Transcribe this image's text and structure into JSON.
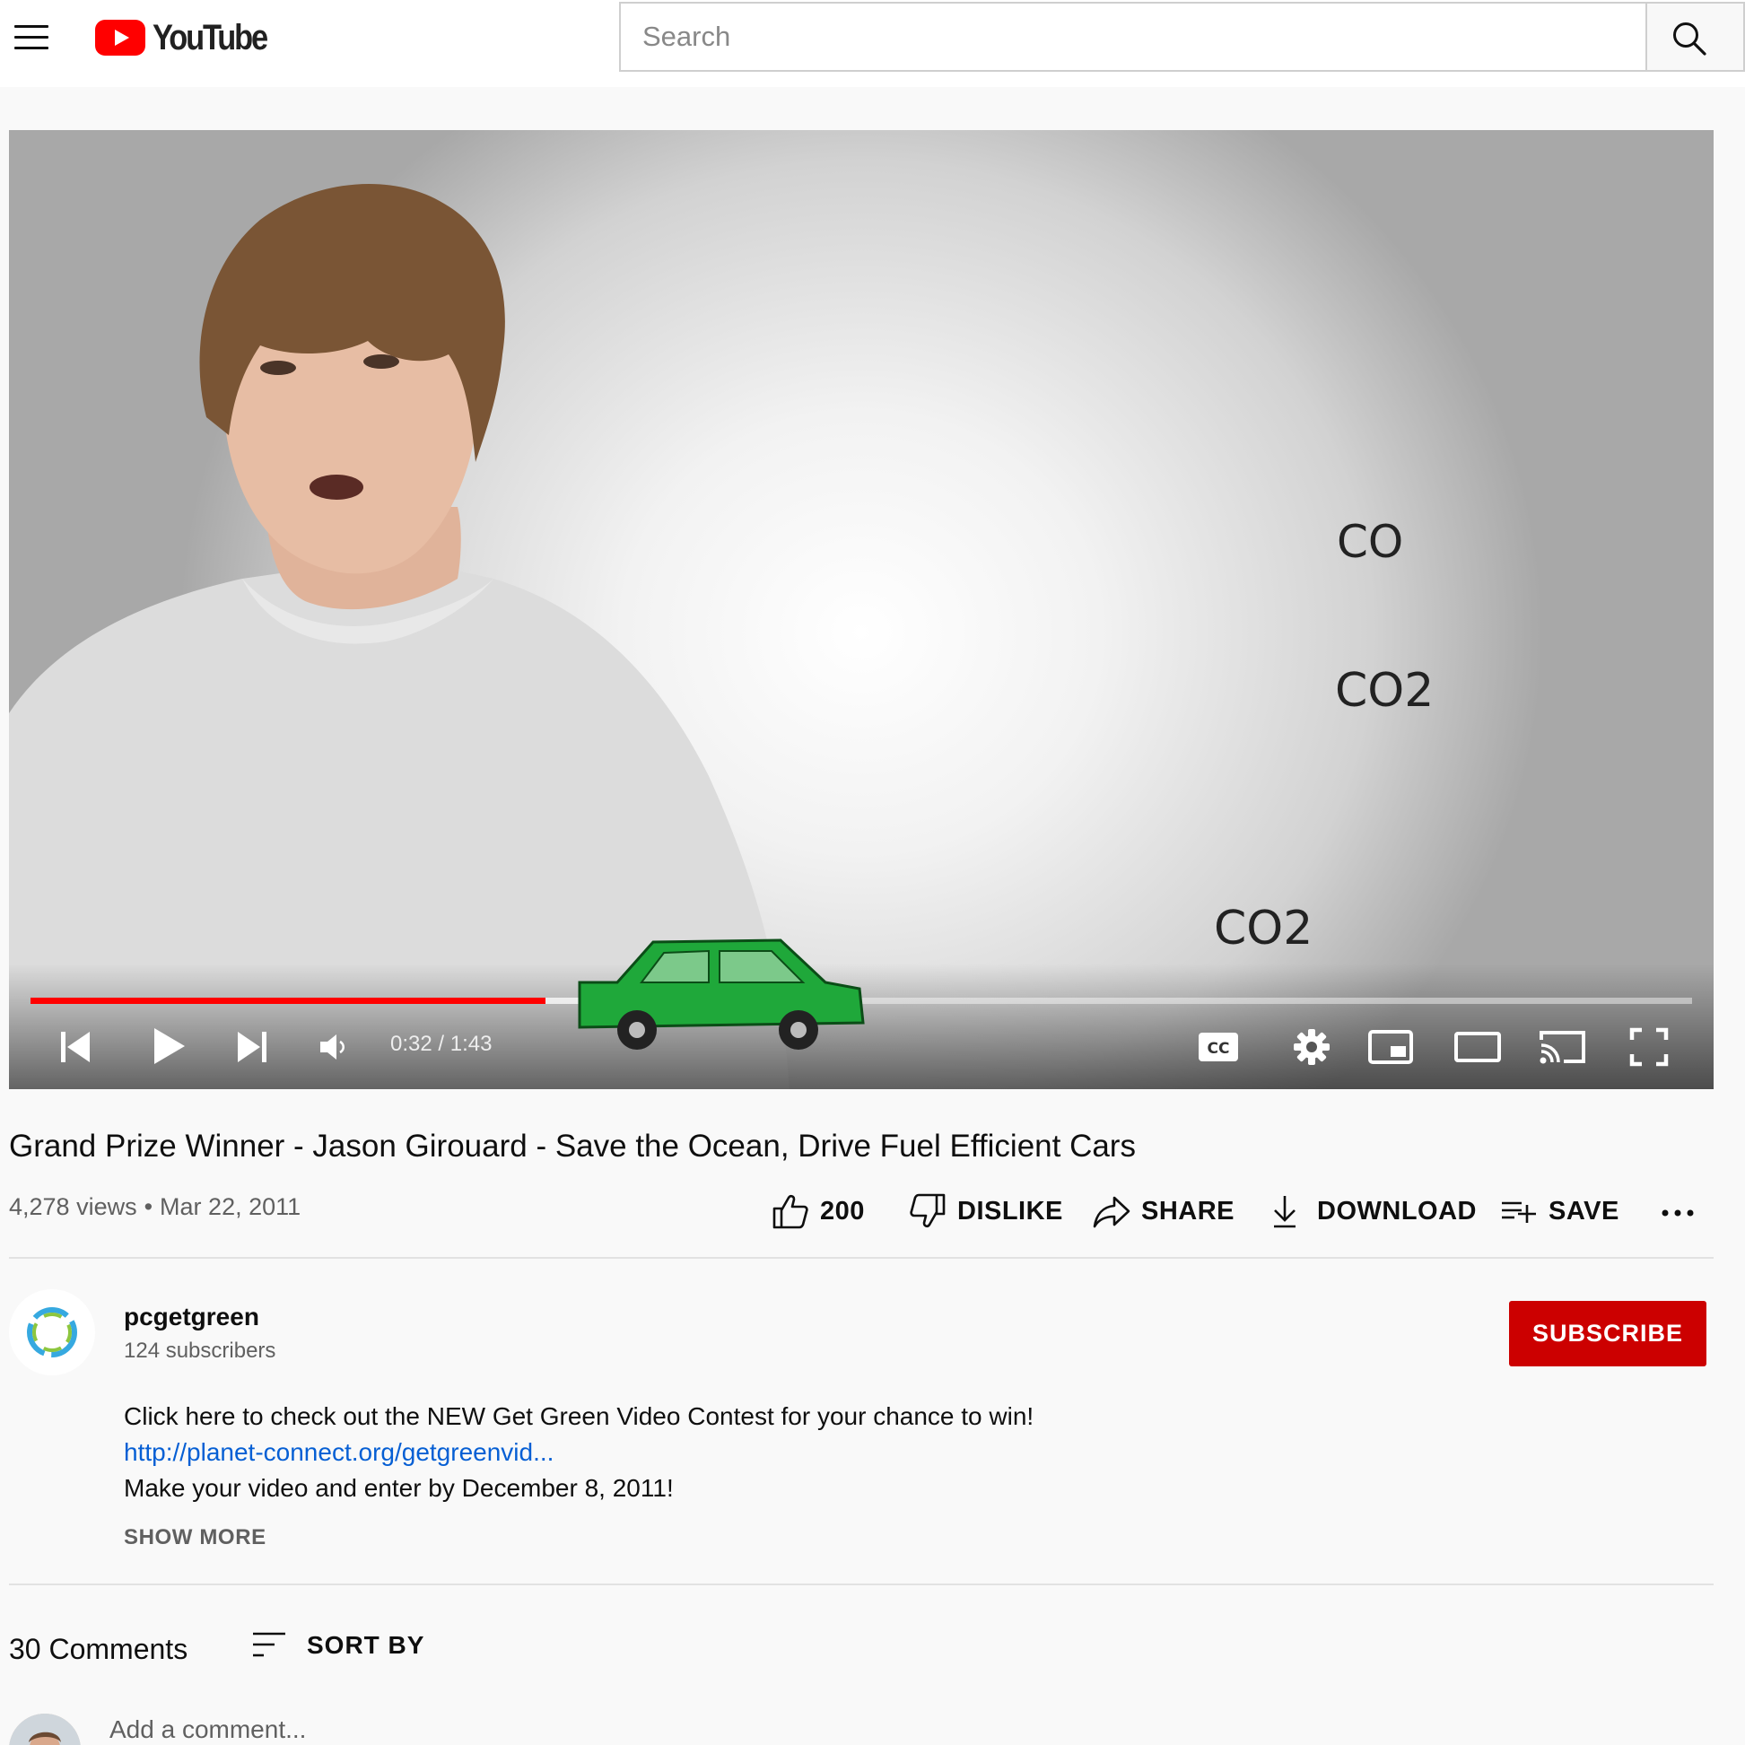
{
  "header": {
    "logo_text": "YouTube",
    "search_placeholder": "Search"
  },
  "player": {
    "overlay_texts": [
      "CO2",
      "CO2",
      "CO"
    ],
    "time_display": "0:32 / 1:43",
    "progress_played_fraction": 0.31,
    "progress_loaded_fraction": 0.5,
    "accent_color": "#ff0000",
    "controls": [
      "previous-icon",
      "play-icon",
      "next-icon",
      "volume-icon",
      "captions-icon",
      "settings-icon",
      "miniplayer-icon",
      "theater-icon",
      "cast-icon",
      "fullscreen-icon"
    ]
  },
  "video": {
    "title": "Grand Prize Winner - Jason Girouard - Save the Ocean, Drive Fuel Efficient Cars",
    "views": "4,278 views",
    "separator": "•",
    "date": "Mar 22, 2011"
  },
  "actions": {
    "like_count": "200",
    "dislike_label": "DISLIKE",
    "share_label": "SHARE",
    "download_label": "DOWNLOAD",
    "save_label": "SAVE"
  },
  "channel": {
    "name": "pcgetgreen",
    "subscribers": "124 subscribers",
    "subscribe_label": "SUBSCRIBE",
    "subscribe_color": "#cc0000"
  },
  "description": {
    "line1": "Click here to check out the NEW Get Green Video Contest for your chance to win!",
    "link": "http://planet-connect.org/getgreenvid...",
    "line3": "Make your video and enter by December 8, 2011!",
    "show_more": "SHOW MORE"
  },
  "comments": {
    "count_label": "30 Comments",
    "sort_label": "SORT BY",
    "add_placeholder": "Add a comment..."
  }
}
